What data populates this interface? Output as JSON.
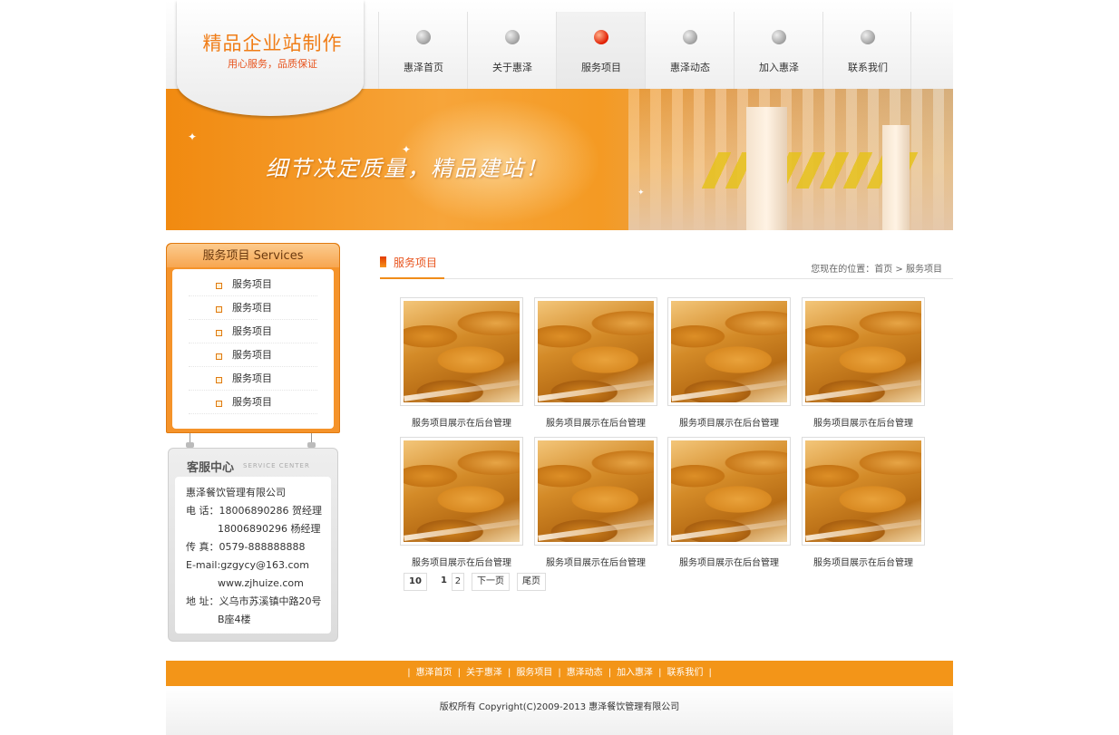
{
  "logo": {
    "title": "精品企业站制作",
    "subtitle": "用心服务，品质保证"
  },
  "nav": {
    "items": [
      {
        "label": "惠泽首页",
        "active": false
      },
      {
        "label": "关于惠泽",
        "active": false
      },
      {
        "label": "服务项目",
        "active": true
      },
      {
        "label": "惠泽动态",
        "active": false
      },
      {
        "label": "加入惠泽",
        "active": false
      },
      {
        "label": "联系我们",
        "active": false
      }
    ]
  },
  "banner": {
    "slogan": "细节决定质量，精品建站！"
  },
  "sidebar": {
    "title": "服务项目  Services",
    "items": [
      "服务项目",
      "服务项目",
      "服务项目",
      "服务项目",
      "服务项目",
      "服务项目"
    ]
  },
  "service_center": {
    "title": "客服中心",
    "subtitle": "SERVICE CENTER",
    "company": "惠泽餐饮管理有限公司",
    "phone1": "电  话：18006890286 贺经理",
    "phone2": "18006890296 杨经理",
    "fax": "传  真：0579-888888888",
    "email": "E-mail:gzgycy@163.com",
    "website": "www.zjhuize.com",
    "address1": "地  址：义乌市苏溪镇中路20号",
    "address2": "B座4楼"
  },
  "main": {
    "title": "服务项目",
    "breadcrumb": "您现在的位置：首页 > 服务项目",
    "items": [
      "服务项目展示在后台管理",
      "服务项目展示在后台管理",
      "服务项目展示在后台管理",
      "服务项目展示在后台管理",
      "服务项目展示在后台管理",
      "服务项目展示在后台管理",
      "服务项目展示在后台管理",
      "服务项目展示在后台管理"
    ]
  },
  "pager": {
    "total": "10",
    "current": "1",
    "next_page_num": "2",
    "next_label": "下一页",
    "last_label": "尾页"
  },
  "footer": {
    "links": [
      "惠泽首页",
      "关于惠泽",
      "服务项目",
      "惠泽动态",
      "加入惠泽",
      "联系我们"
    ],
    "copyright": "版权所有 Copyright(C)2009-2013 惠泽餐饮管理有限公司"
  }
}
